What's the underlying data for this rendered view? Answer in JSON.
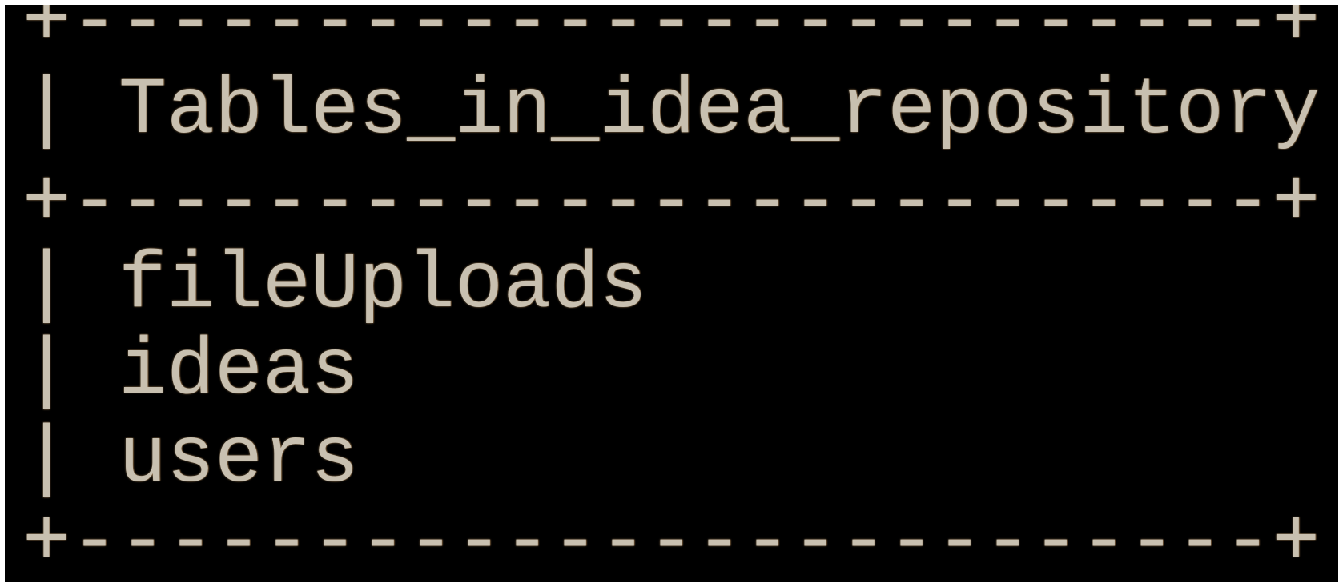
{
  "terminal": {
    "border_top": "+-------------------------+",
    "header_row": "| Tables_in_idea_repository |",
    "border_mid": "+-------------------------+",
    "rows": [
      "| fileUploads               |",
      "| ideas                     |",
      "| users                     |"
    ],
    "border_bottom": "+-------------------------+"
  },
  "colors": {
    "background": "#000000",
    "text": "#c8c0b0",
    "glow": "#a0825a"
  }
}
